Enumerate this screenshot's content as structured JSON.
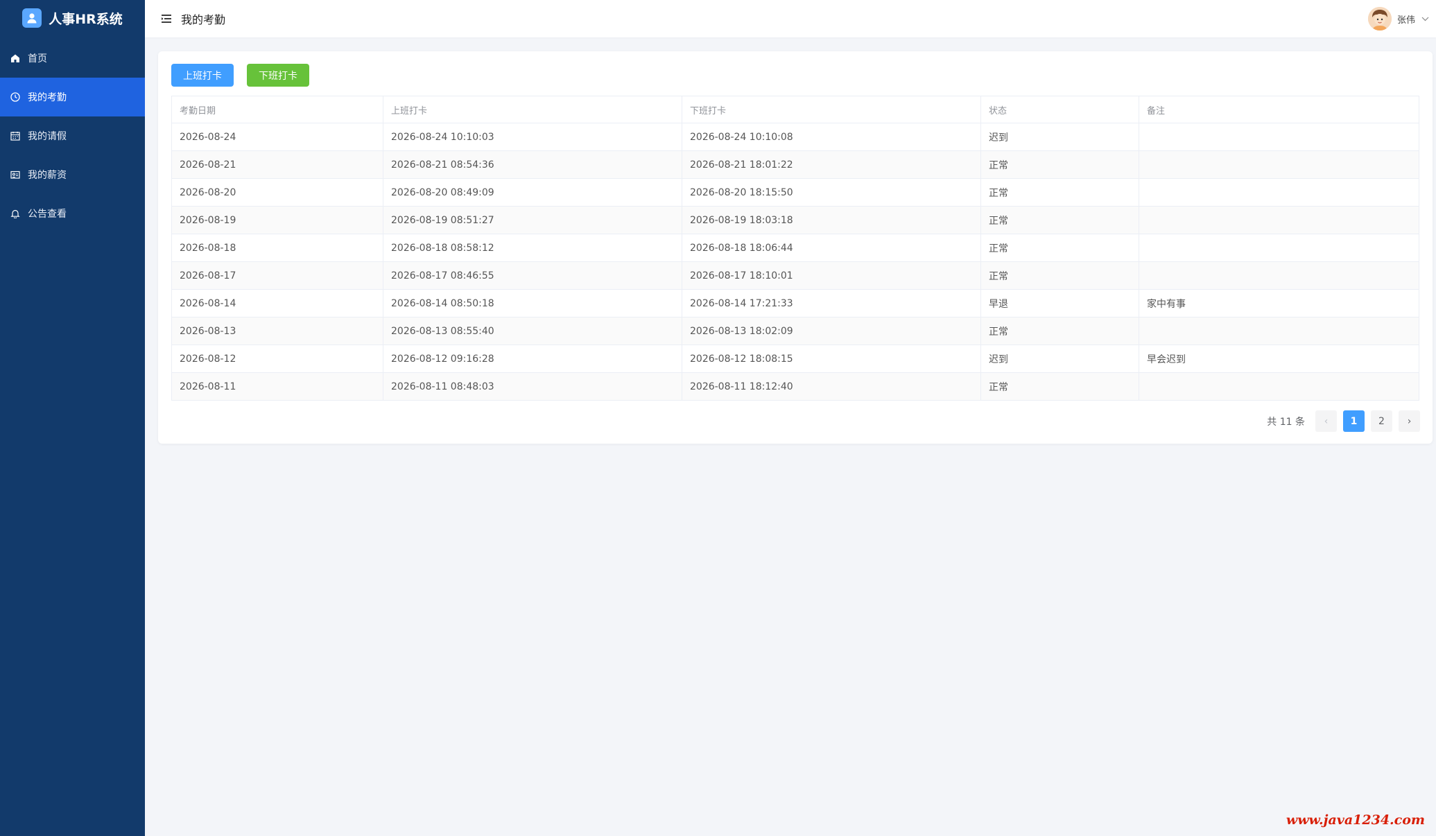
{
  "app": {
    "brand_name": "人事HR系统"
  },
  "sidebar": {
    "items": [
      {
        "label": "首页",
        "icon": "home-icon",
        "active": false
      },
      {
        "label": "我的考勤",
        "icon": "clock-icon",
        "active": true
      },
      {
        "label": "我的请假",
        "icon": "calendar-icon",
        "active": false
      },
      {
        "label": "我的薪资",
        "icon": "wallet-icon",
        "active": false
      },
      {
        "label": "公告查看",
        "icon": "bell-icon",
        "active": false
      }
    ]
  },
  "header": {
    "title": "我的考勤",
    "user_name": "张伟"
  },
  "actions": {
    "clock_in_label": "上班打卡",
    "clock_out_label": "下班打卡"
  },
  "table": {
    "columns": [
      "考勤日期",
      "上班打卡",
      "下班打卡",
      "状态",
      "备注"
    ],
    "rows": [
      [
        "2026-08-24",
        "2026-08-24 10:10:03",
        "2026-08-24 10:10:08",
        "迟到",
        ""
      ],
      [
        "2026-08-21",
        "2026-08-21 08:54:36",
        "2026-08-21 18:01:22",
        "正常",
        ""
      ],
      [
        "2026-08-20",
        "2026-08-20 08:49:09",
        "2026-08-20 18:15:50",
        "正常",
        ""
      ],
      [
        "2026-08-19",
        "2026-08-19 08:51:27",
        "2026-08-19 18:03:18",
        "正常",
        ""
      ],
      [
        "2026-08-18",
        "2026-08-18 08:58:12",
        "2026-08-18 18:06:44",
        "正常",
        ""
      ],
      [
        "2026-08-17",
        "2026-08-17 08:46:55",
        "2026-08-17 18:10:01",
        "正常",
        ""
      ],
      [
        "2026-08-14",
        "2026-08-14 08:50:18",
        "2026-08-14 17:21:33",
        "早退",
        "家中有事"
      ],
      [
        "2026-08-13",
        "2026-08-13 08:55:40",
        "2026-08-13 18:02:09",
        "正常",
        ""
      ],
      [
        "2026-08-12",
        "2026-08-12 09:16:28",
        "2026-08-12 18:08:15",
        "迟到",
        "早会迟到"
      ],
      [
        "2026-08-11",
        "2026-08-11 08:48:03",
        "2026-08-11 18:12:40",
        "正常",
        ""
      ]
    ]
  },
  "pagination": {
    "total_label": "共 11 条",
    "prev_icon": "‹",
    "next_icon": "›",
    "pages": [
      "1",
      "2"
    ],
    "current": "1"
  },
  "watermark": "www.java1234.com",
  "colors": {
    "sidebar_bg": "#123a6b",
    "sidebar_active": "#1f63e0",
    "primary": "#409eff",
    "success": "#67c23a"
  }
}
